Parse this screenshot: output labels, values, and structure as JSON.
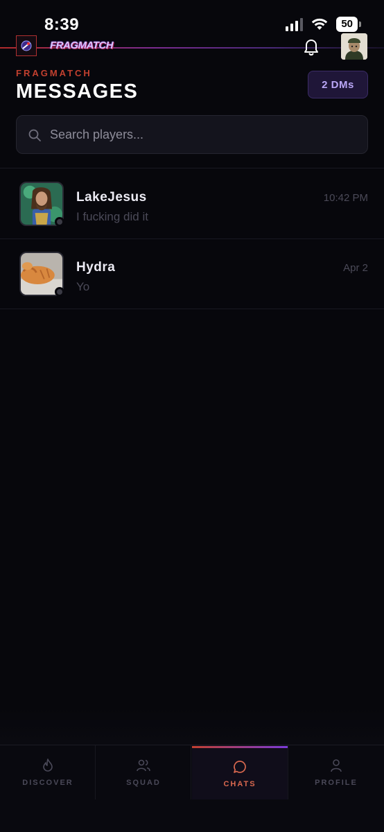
{
  "status_bar": {
    "time": "8:39",
    "battery": "50"
  },
  "app": {
    "logo_text": "FRAGMATCH"
  },
  "header": {
    "eyebrow": "FRAGMATCH",
    "title": "MESSAGES",
    "dm_badge": "2 DMs"
  },
  "search": {
    "placeholder": "Search players..."
  },
  "chats": [
    {
      "name": "LakeJesus",
      "preview": "I fucking did it",
      "time": "10:42 PM"
    },
    {
      "name": "Hydra",
      "preview": "Yo",
      "time": "Apr 2"
    }
  ],
  "nav": {
    "items": [
      {
        "label": "DISCOVER",
        "icon": "flame-icon"
      },
      {
        "label": "SQUAD",
        "icon": "users-icon"
      },
      {
        "label": "CHATS",
        "icon": "chat-bubble-icon",
        "active": true
      },
      {
        "label": "PROFILE",
        "icon": "person-icon"
      }
    ]
  },
  "colors": {
    "accent_red": "#c2402f",
    "accent_purple": "#7a3ad9",
    "background": "#07070c"
  }
}
